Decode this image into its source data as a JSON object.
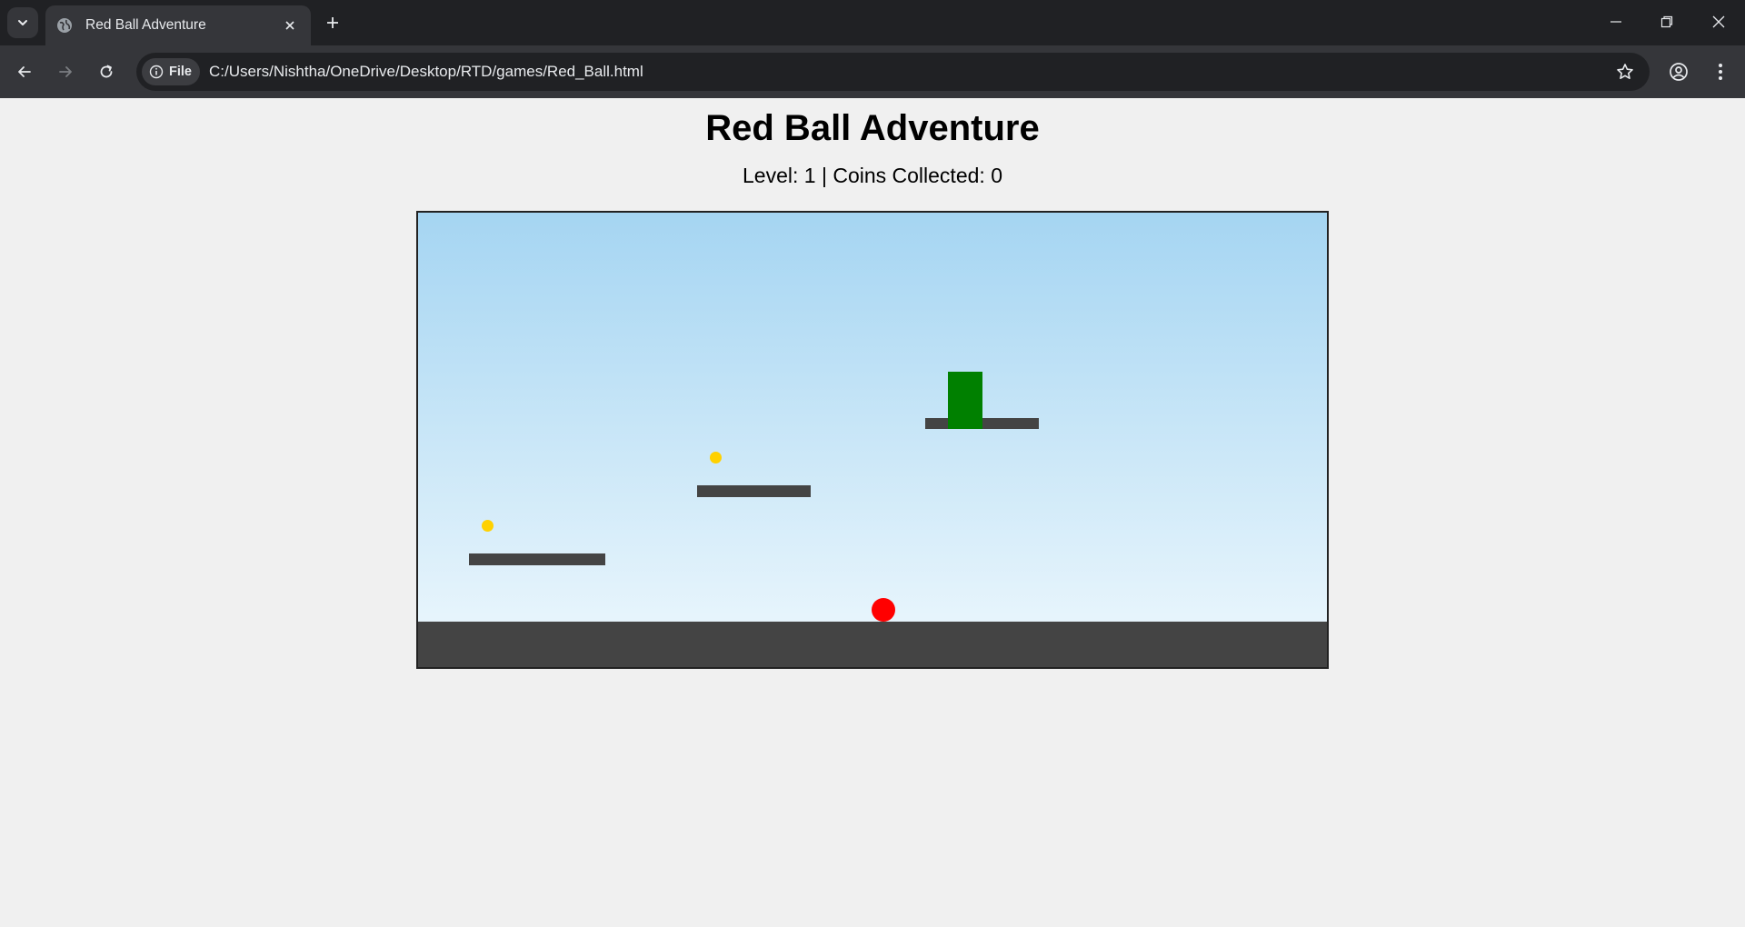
{
  "browser": {
    "tab_title": "Red Ball Adventure",
    "site_chip_label": "File",
    "url": "C:/Users/Nishtha/OneDrive/Desktop/RTD/games/Red_Ball.html"
  },
  "page": {
    "title": "Red Ball Adventure",
    "level_label": "Level:",
    "level": 1,
    "coins_label": "Coins Collected:",
    "coins": 0
  },
  "colors": {
    "sky_top": "#a5d5f2",
    "sky_bottom": "#eef8fd",
    "ground": "#444444",
    "platform": "#444444",
    "coin": "#ffd100",
    "goal": "#008000",
    "ball": "#ff0000"
  },
  "game": {
    "platforms": 3,
    "coins_remaining": 2,
    "has_goal": true
  }
}
